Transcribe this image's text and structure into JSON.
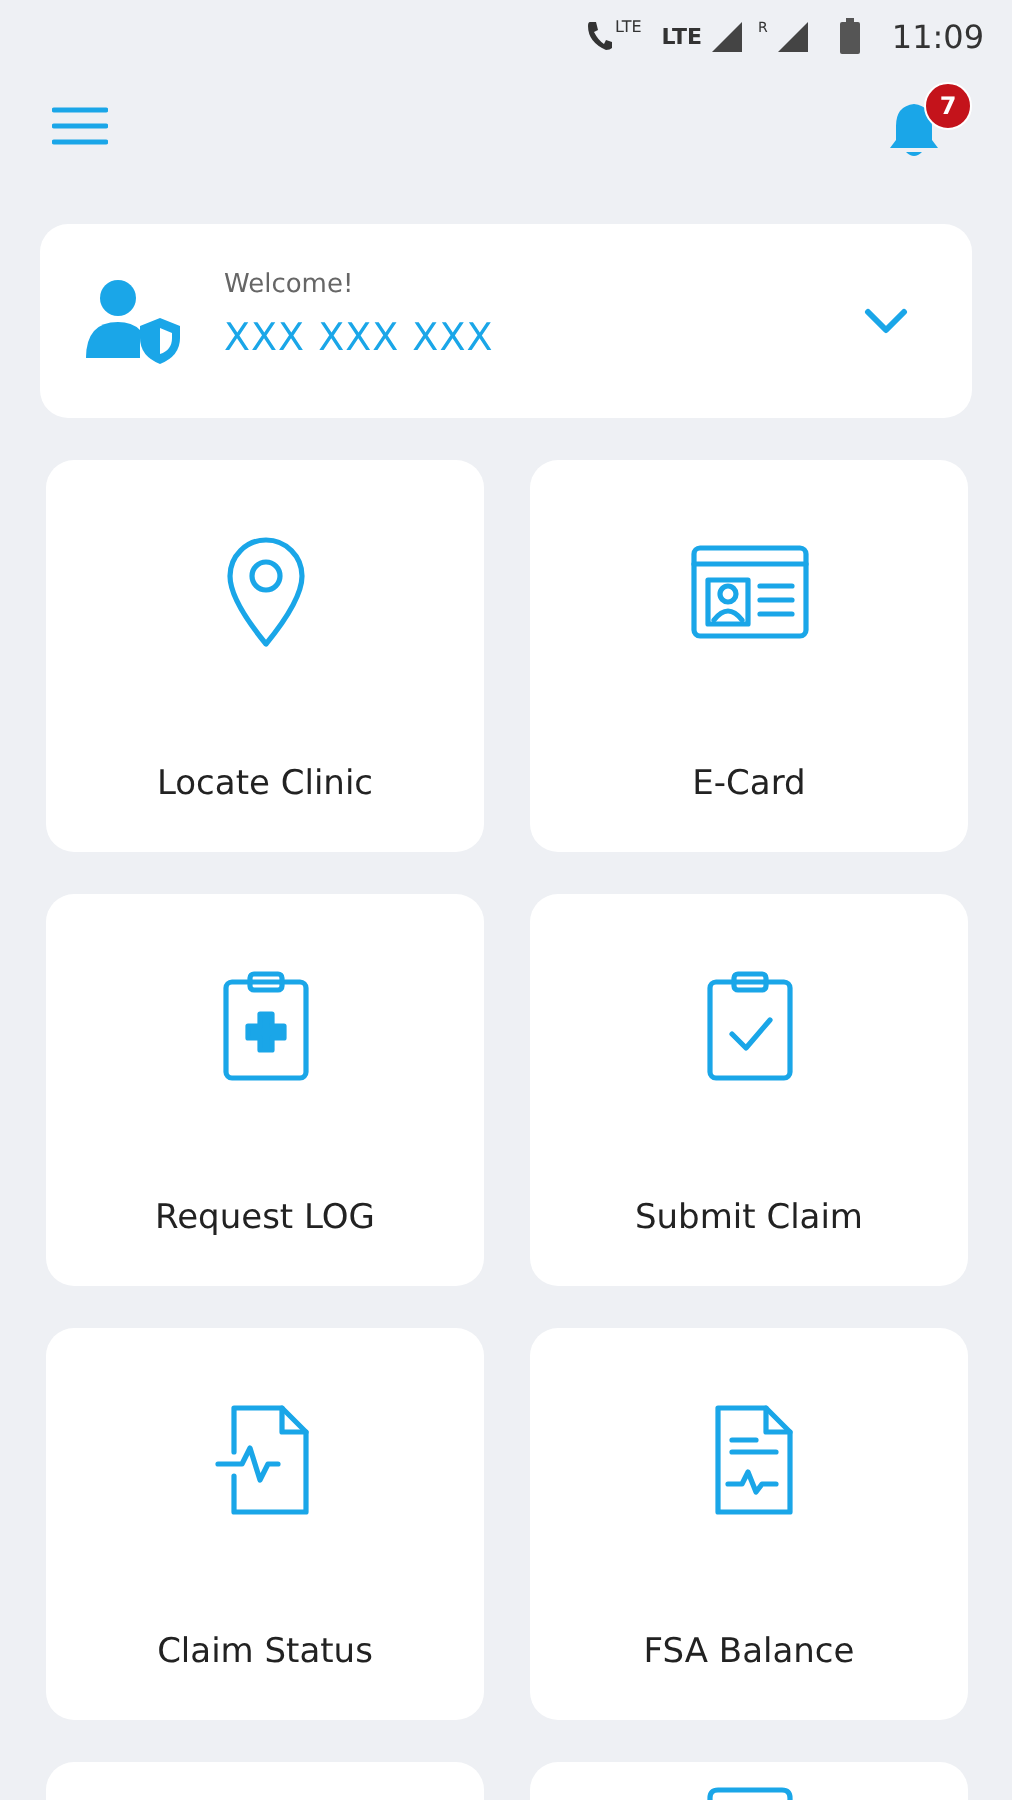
{
  "status_bar": {
    "call_badge": "LTE",
    "network": "LTE",
    "roaming": "R",
    "time": "11:09"
  },
  "header": {
    "notification_count": "7"
  },
  "welcome": {
    "greeting": "Welcome!",
    "name": "XXX XXX XXX"
  },
  "tiles": [
    {
      "label": "Locate Clinic"
    },
    {
      "label": "E-Card"
    },
    {
      "label": "Request LOG"
    },
    {
      "label": "Submit Claim"
    },
    {
      "label": "Claim Status"
    },
    {
      "label": "FSA Balance"
    }
  ]
}
